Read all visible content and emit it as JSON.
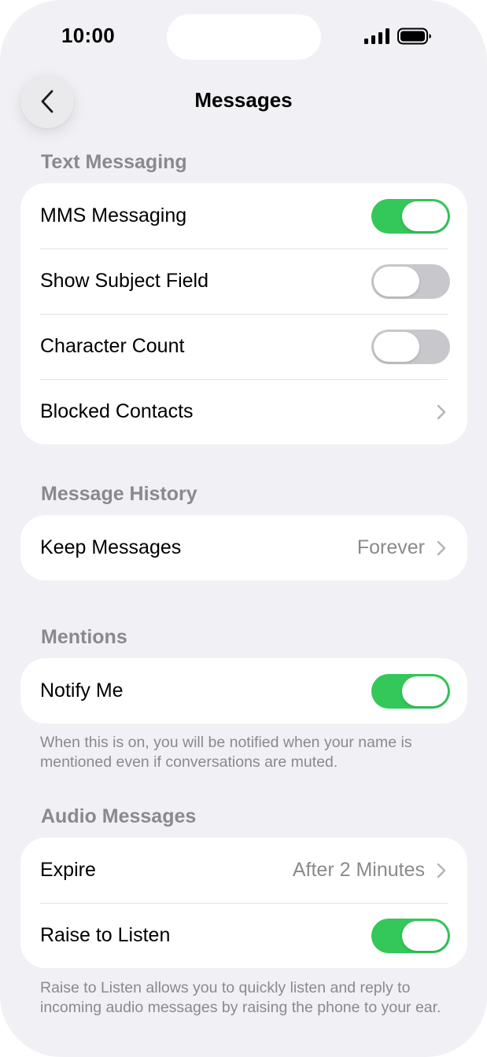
{
  "status_bar": {
    "time": "10:00",
    "signal_icon": "cellular-signal-icon",
    "battery_icon": "battery-icon"
  },
  "nav": {
    "title": "Messages",
    "back_icon": "chevron-left-icon"
  },
  "colors": {
    "background": "#f1f1f5",
    "group_background": "#ffffff",
    "toggle_on": "#34c759",
    "toggle_off": "#c8c8cc",
    "secondary_text": "#8a8a8e"
  },
  "sections": {
    "text_messaging": {
      "header": "Text Messaging",
      "rows": [
        {
          "label": "MMS Messaging",
          "type": "toggle",
          "on": true
        },
        {
          "label": "Show Subject Field",
          "type": "toggle",
          "on": false
        },
        {
          "label": "Character Count",
          "type": "toggle",
          "on": false
        },
        {
          "label": "Blocked Contacts",
          "type": "disclosure"
        }
      ]
    },
    "message_history": {
      "header": "Message History",
      "rows": [
        {
          "label": "Keep Messages",
          "type": "disclosure",
          "value": "Forever"
        }
      ]
    },
    "mentions": {
      "header": "Mentions",
      "rows": [
        {
          "label": "Notify Me",
          "type": "toggle",
          "on": true
        }
      ],
      "footer": "When this is on, you will be notified when your name is mentioned even if conversations are muted."
    },
    "audio_messages": {
      "header": "Audio Messages",
      "rows": [
        {
          "label": "Expire",
          "type": "disclosure",
          "value": "After 2 Minutes"
        },
        {
          "label": "Raise to Listen",
          "type": "toggle",
          "on": true
        }
      ],
      "footer": "Raise to Listen allows you to quickly listen and reply to incoming audio messages by raising the phone to your ear."
    }
  }
}
